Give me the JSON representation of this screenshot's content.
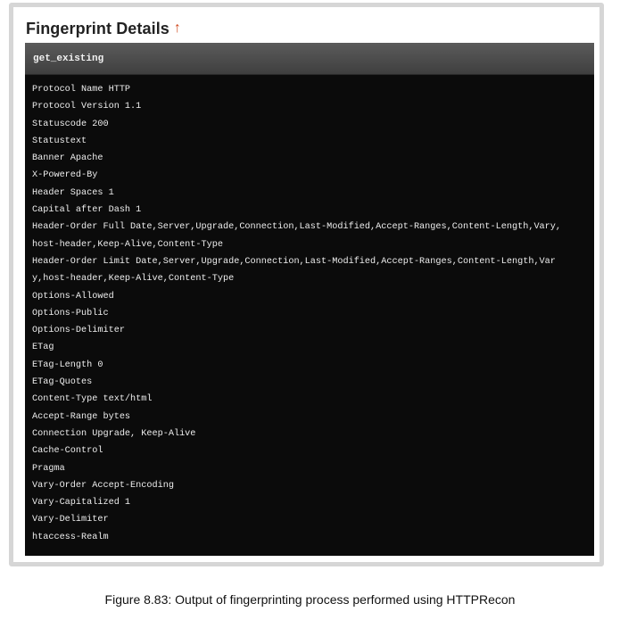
{
  "section": {
    "title": "Fingerprint Details",
    "up_icon": "up-arrow-icon"
  },
  "panel": {
    "header": "get_existing",
    "lines": [
      "Protocol Name HTTP",
      "Protocol Version 1.1",
      "Statuscode 200",
      "Statustext",
      "Banner Apache",
      "X-Powered-By",
      "Header Spaces 1",
      "Capital after Dash 1",
      "Header-Order Full Date,Server,Upgrade,Connection,Last-Modified,Accept-Ranges,Content-Length,Vary,",
      "host-header,Keep-Alive,Content-Type",
      "Header-Order Limit Date,Server,Upgrade,Connection,Last-Modified,Accept-Ranges,Content-Length,Var",
      "y,host-header,Keep-Alive,Content-Type",
      "Options-Allowed",
      "Options-Public",
      "Options-Delimiter",
      "ETag",
      "ETag-Length 0",
      "ETag-Quotes",
      "Content-Type text/html",
      "Accept-Range bytes",
      "Connection Upgrade, Keep-Alive",
      "Cache-Control",
      "Pragma",
      "Vary-Order Accept-Encoding",
      "Vary-Capitalized 1",
      "Vary-Delimiter",
      "htaccess-Realm"
    ]
  },
  "caption": "Figure 8.83: Output of fingerprinting process performed using HTTPRecon",
  "colors": {
    "title_arrow": "#d04a1f",
    "panel_bg": "#0b0b0b",
    "header_bg": "#4d4d4d"
  }
}
